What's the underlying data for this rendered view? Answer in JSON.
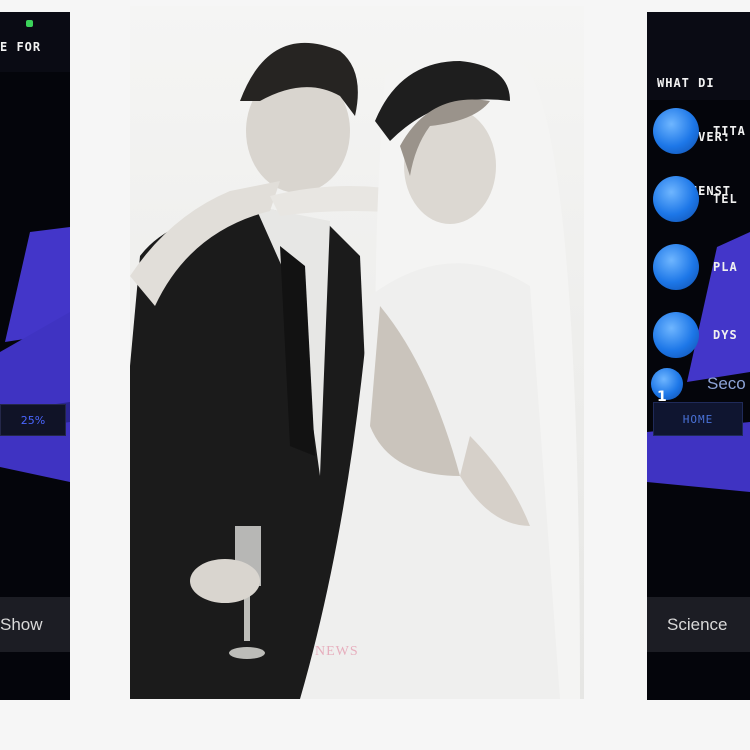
{
  "left_screenshot": {
    "header_text": "E FOR",
    "progress_label": "25%",
    "footer_label": "Show"
  },
  "center_photo": {
    "description_icon": "wedding-photo",
    "watermark": "NEWS"
  },
  "right_screenshot": {
    "header_lines": [
      "WHAT DI",
      "DISCOVER:",
      "REICHENST"
    ],
    "answers": [
      {
        "label": "TITA"
      },
      {
        "label": "TEL"
      },
      {
        "label": "PLA"
      },
      {
        "label": "DYS"
      }
    ],
    "question_number": "1",
    "partial_answer": "Seco",
    "home_label": "HOME",
    "footer_label": "Science"
  },
  "colors": {
    "app_background": "#04050b",
    "accent_blue": "#4a3cd6",
    "answer_bubble": "#1d77e8",
    "status_green": "#3bd35a"
  }
}
